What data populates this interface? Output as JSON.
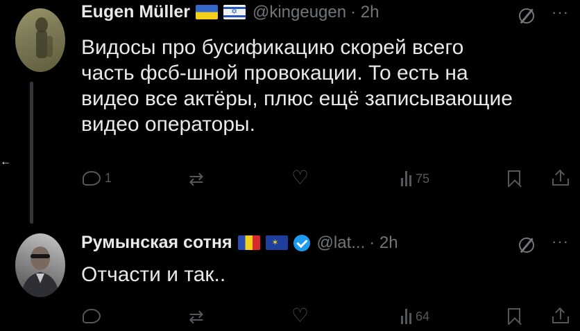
{
  "tweets": [
    {
      "author_name": "Eugen Müller",
      "handle": "@kingeugen",
      "time": "· 2h",
      "flags": [
        "ua-flag",
        "il-flag"
      ],
      "text_lines": [
        "Видосы про бусификацию скорей всего",
        "часть фсб-шной провокации. То есть на",
        "видео все актёры, плюс ещё записывающие",
        "видео операторы."
      ],
      "actions": {
        "replies": "1",
        "retweets": "",
        "likes": "",
        "views": "75"
      }
    },
    {
      "author_name": "Румынская сотня",
      "handle": "@lat...",
      "time": "· 2h",
      "flags": [
        "ro-flag",
        "eu-flag"
      ],
      "verified": true,
      "text_lines": [
        "Отчасти и так.."
      ],
      "actions": {
        "replies": "",
        "retweets": "",
        "likes": "",
        "views": "64"
      }
    }
  ],
  "icons": {
    "thread_back": "←",
    "more": "···",
    "il_star": "✡",
    "eu_stars": "✶"
  },
  "colors": {
    "background": "#000000",
    "text": "#e7e9ea",
    "muted": "#71767b",
    "verified": "#1d9bf0"
  }
}
